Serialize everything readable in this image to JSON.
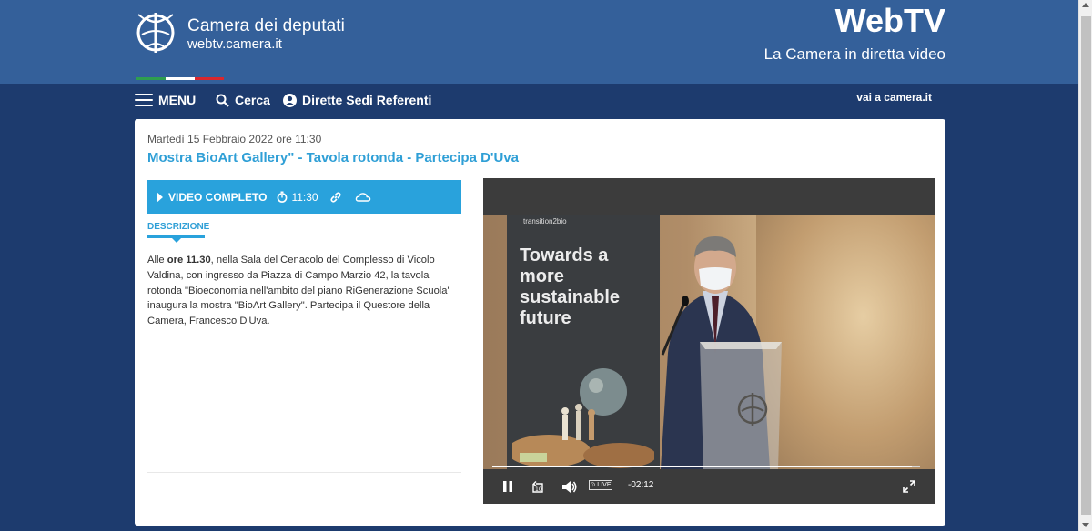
{
  "header": {
    "brand_title": "Camera dei deputati",
    "brand_url": "webtv.camera.it",
    "site_title": "WebTV",
    "site_subtitle": "La Camera in diretta video",
    "tricolor": [
      "#2e9e4f",
      "#ffffff",
      "#d9272e"
    ]
  },
  "nav": {
    "menu_label": "MENU",
    "search_label": "Cerca",
    "live_label": "Dirette Sedi Referenti",
    "external_label": "vai a camera.it"
  },
  "event": {
    "date": "Martedì 15 Febbraio 2022 ore 11:30",
    "title": "Mostra BioArt Gallery\" - Tavola rotonda - Partecipa D'Uva"
  },
  "tabs": {
    "video_label": "VIDEO COMPLETO",
    "duration": "11:30"
  },
  "description": {
    "label": "DESCRIZIONE",
    "intro": "Alle ",
    "time_bold": "ore 11.30",
    "body": ", nella Sala del Cenacolo del Complesso di Vicolo Valdina, con ingresso da Piazza di Campo Marzio 42, la tavola rotonda \"Bioeconomia nell'ambito del piano RiGenerazione Scuola\" inaugura la mostra \"BioArt Gallery\". Partecipa il Questore della Camera, Francesco D'Uva."
  },
  "video": {
    "banner_brand": "transition2bio",
    "banner_text": "Towards a more sustainable future",
    "live_badge": "⊙ LIVE",
    "time_remaining": "-02:12",
    "progress": 0.98
  },
  "colors": {
    "header_bg": "#34609a",
    "page_bg": "#1d3b6e",
    "accent": "#29a2dc",
    "title_blue": "#2f9fd6"
  }
}
